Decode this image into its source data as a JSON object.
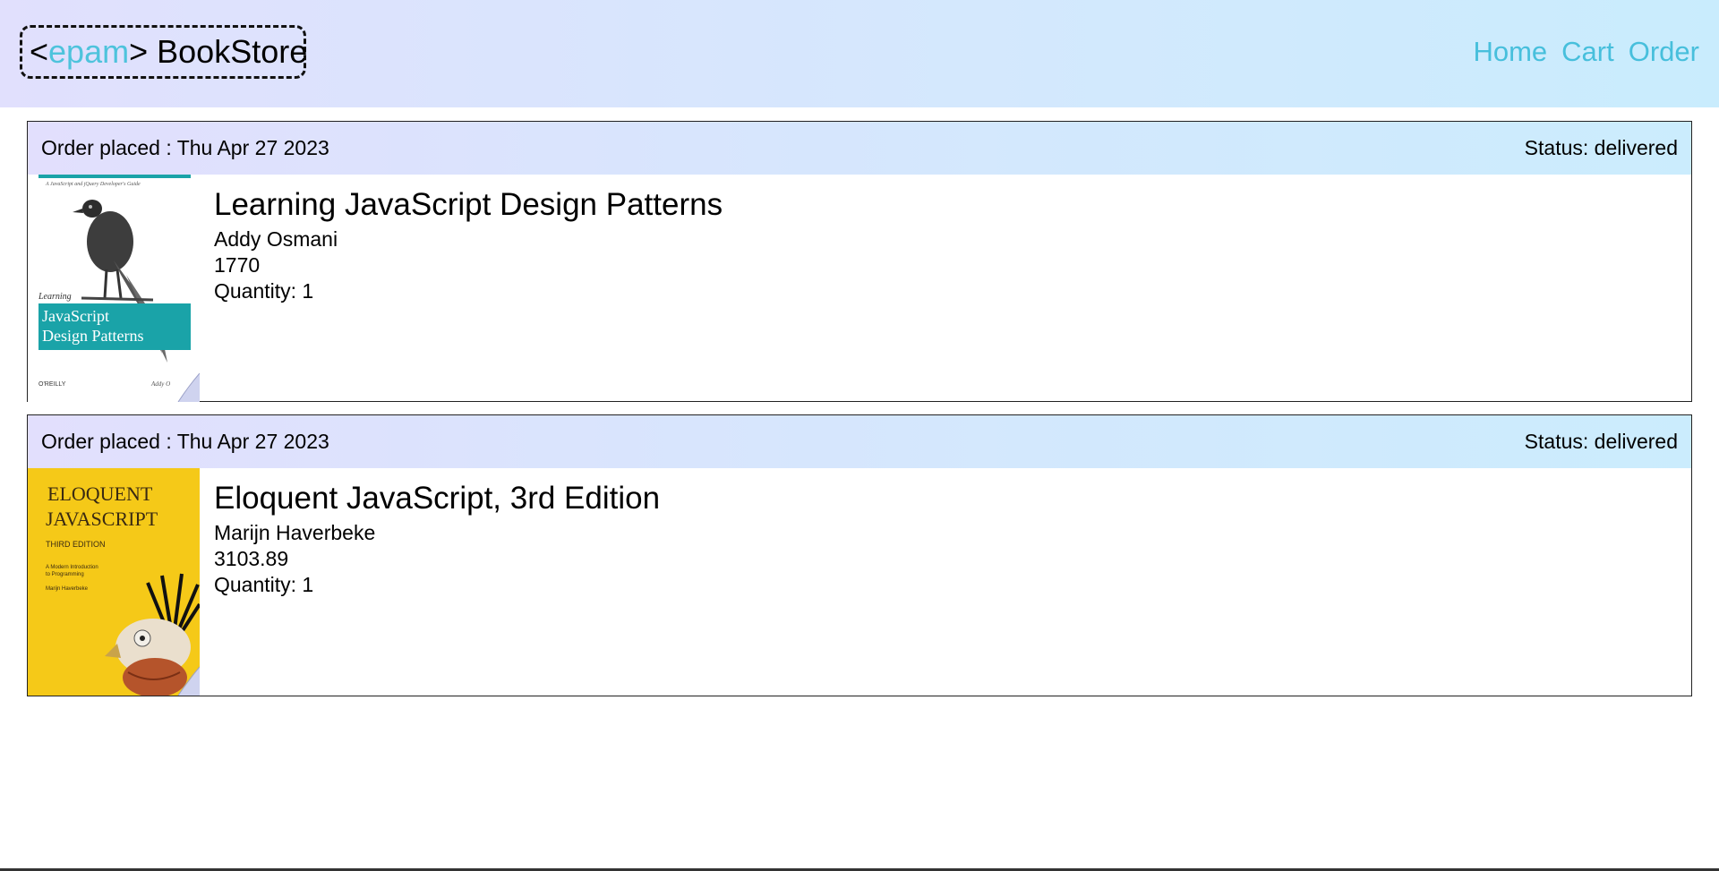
{
  "header": {
    "logo": {
      "open": "<",
      "brand": "epam",
      "close": ">",
      "name": "BookStore"
    },
    "nav": [
      "Home",
      "Cart",
      "Order"
    ]
  },
  "orders": [
    {
      "placed_label": "Order placed : Thu Apr 27 2023",
      "status_label": "Status: delivered",
      "book": {
        "title": "Learning JavaScript Design Patterns",
        "author": "Addy Osmani",
        "price": "1770",
        "quantity": "Quantity: 1"
      },
      "cover": {
        "tagline": "A JavaScript and jQuery Developer's Guide",
        "small_title": "Learning",
        "title_line1": "JavaScript",
        "title_line2": "Design Patterns",
        "publisher": "O'REILLY",
        "author_short": "Addy O",
        "accent": "#1aa3a8"
      }
    },
    {
      "placed_label": "Order placed : Thu Apr 27 2023",
      "status_label": "Status: delivered",
      "book": {
        "title": "Eloquent JavaScript, 3rd Edition",
        "author": "Marijn Haverbeke",
        "price": "3103.89",
        "quantity": "Quantity: 1"
      },
      "cover": {
        "title_line1": "ELOQUENT",
        "title_line2": "JAVASCRIPT",
        "edition": "THIRD EDITION",
        "subtitle1": "A Modern Introduction",
        "subtitle2": "to Programming",
        "author_small": "Marijn Haverbeke",
        "background": "#f5c918"
      }
    }
  ],
  "colors": {
    "link": "#47bfdc",
    "brand": "#4ec3dc"
  }
}
